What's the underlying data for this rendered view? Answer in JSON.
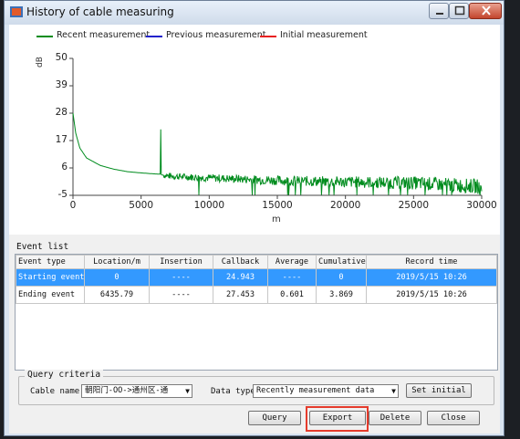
{
  "window": {
    "title": "History of cable measuring"
  },
  "chart_data": {
    "type": "line",
    "title": "",
    "xlabel": "m",
    "ylabel": "dB",
    "xlim": [
      0,
      30000
    ],
    "ylim": [
      -5,
      50
    ],
    "xticks": [
      0,
      5000,
      10000,
      15000,
      20000,
      25000,
      30000
    ],
    "yticks": [
      -5,
      6,
      17,
      28,
      39,
      50
    ],
    "legend_position": "top",
    "series": [
      {
        "name": "Recent measurement",
        "color": "#008c1e",
        "x": [
          0,
          200,
          500,
          1000,
          1500,
          2000,
          3000,
          4000,
          5000,
          6000,
          6430,
          6440,
          6460,
          6500,
          7000,
          8000,
          10000,
          12000,
          15000,
          18000,
          20000,
          25000,
          30000
        ],
        "y": [
          28,
          20,
          14,
          10,
          8.5,
          7,
          5.5,
          4.5,
          4,
          3.6,
          3.5,
          21.5,
          3.5,
          3.2,
          2.8,
          2.5,
          2,
          1.6,
          1,
          0.6,
          0.4,
          0,
          -1.5
        ]
      },
      {
        "name": "Previous measurement",
        "color": "#2222cc",
        "x": [],
        "y": []
      },
      {
        "name": "Initial measurement",
        "color": "#e82020",
        "x": [],
        "y": []
      }
    ]
  },
  "event_list": {
    "label": "Event list",
    "columns": [
      "Event type",
      "Location/m",
      "Insertion",
      "Callback",
      "Average",
      "Cumulative",
      "Record time"
    ],
    "rows": [
      {
        "event_type": "Starting event",
        "location": "0",
        "insertion": "----",
        "callback": "24.943",
        "average": "----",
        "cumulative": "0",
        "record_time": "2019/5/15 10:26",
        "selected": true
      },
      {
        "event_type": "Ending event",
        "location": "6435.79",
        "insertion": "----",
        "callback": "27.453",
        "average": "0.601",
        "cumulative": "3.869",
        "record_time": "2019/5/15 10:26",
        "selected": false
      }
    ]
  },
  "query": {
    "label": "Query criteria",
    "cable_name_label": "Cable name",
    "cable_name_value": "朝阳门-OO->通州区-通",
    "data_type_label": "Data type",
    "data_type_value": "Recently measurement data",
    "set_initial_label": "Set initial"
  },
  "buttons": {
    "query": "Query",
    "export": "Export",
    "delete": "Delete",
    "close": "Close"
  },
  "colors": {
    "selection": "#3399ff",
    "export_highlight": "#e53b2c"
  }
}
